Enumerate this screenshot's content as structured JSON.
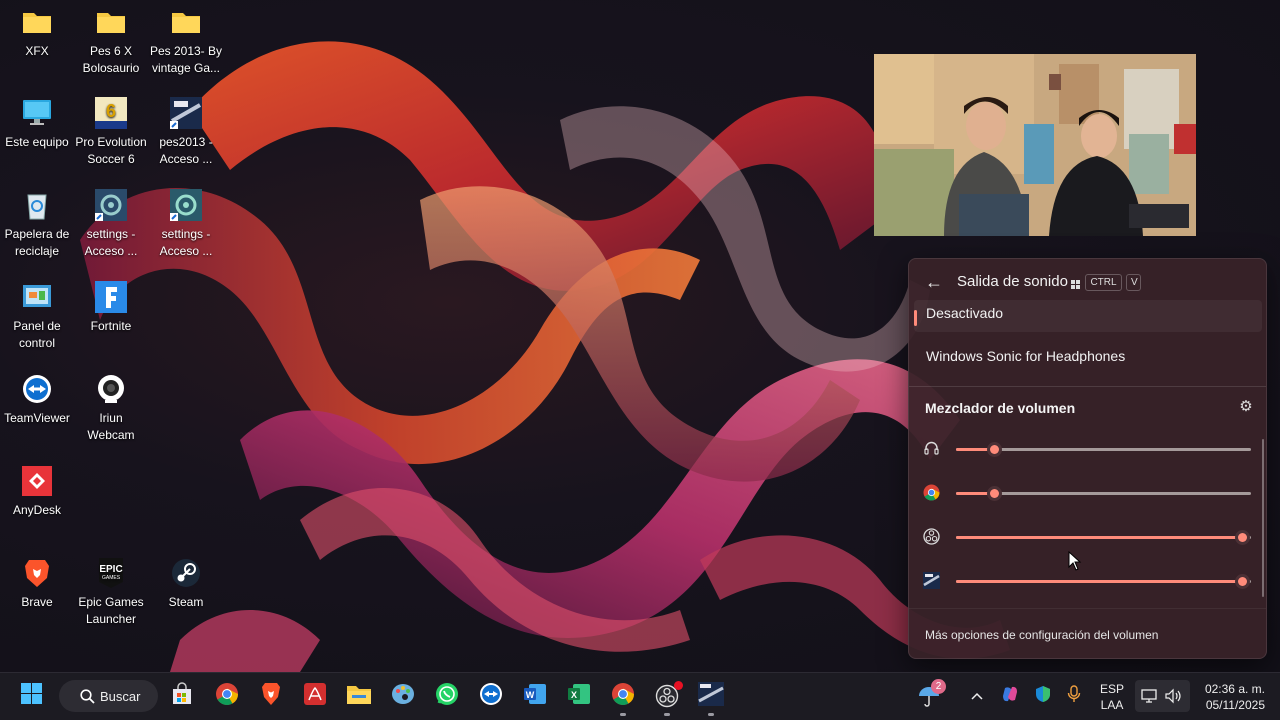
{
  "desktop": {
    "icons": [
      {
        "label": "XFX",
        "icon": "folder-icon"
      },
      {
        "label": "Pes 6 X\nBolosaurio",
        "icon": "folder-icon"
      },
      {
        "label": "Pes 2013- By\nvintage Ga...",
        "icon": "folder-icon"
      },
      {
        "label": "Este equipo",
        "icon": "computer-icon"
      },
      {
        "label": "Pro Evolution\nSoccer 6",
        "icon": "pes6-icon"
      },
      {
        "label": "pes2013 -\nAcceso ...",
        "icon": "pes2013-icon"
      },
      {
        "label": "Papelera de\nreciclaje",
        "icon": "recycle-bin-icon"
      },
      {
        "label": "settings -\nAcceso ...",
        "icon": "settings-shortcut-icon"
      },
      {
        "label": "settings -\nAcceso ...",
        "icon": "settings-shortcut-icon"
      },
      {
        "label": "Panel de\ncontrol",
        "icon": "control-panel-icon"
      },
      {
        "label": "Fortnite",
        "icon": "fortnite-icon"
      },
      {
        "label": "TeamViewer",
        "icon": "teamviewer-icon"
      },
      {
        "label": "Iriun\nWebcam",
        "icon": "iriun-webcam-icon"
      },
      {
        "label": "AnyDesk",
        "icon": "anydesk-icon"
      },
      {
        "label": "Brave",
        "icon": "brave-icon"
      },
      {
        "label": "Epic Games\nLauncher",
        "icon": "epic-games-icon"
      },
      {
        "label": "Steam",
        "icon": "steam-icon"
      }
    ]
  },
  "flyout": {
    "title": "Salida de sonido",
    "shortcut_keys": [
      "CTRL",
      "V"
    ],
    "spatial_options": [
      {
        "label": "Desactivado",
        "selected": true
      },
      {
        "label": "Windows Sonic for Headphones",
        "selected": false
      }
    ],
    "mixer_title": "Mezclador de volumen",
    "mixer_rows": [
      {
        "app_icon": "headphones-icon",
        "volume_fraction": 0.13
      },
      {
        "app_icon": "chrome-icon",
        "volume_fraction": 0.13
      },
      {
        "app_icon": "obs-icon",
        "volume_fraction": 0.97
      },
      {
        "app_icon": "pes2013-app-icon",
        "volume_fraction": 0.97
      }
    ],
    "footer": "Más opciones de configuración del volumen"
  },
  "taskbar": {
    "search_label": "Buscar",
    "apps": [
      "start-icon",
      "store-icon",
      "chrome-icon",
      "brave-icon",
      "acrobat-icon",
      "file-explorer-icon",
      "paint-icon",
      "whatsapp-icon",
      "teamviewer-icon",
      "word-icon",
      "excel-icon",
      "chrome-icon",
      "obs-icon",
      "pes2013-icon"
    ],
    "weather_badge": "2",
    "language_line1": "ESP",
    "language_line2": "LAA",
    "time": "02:36 a. m.",
    "date": "05/11/2025"
  },
  "colors": {
    "accent": "#ff8b7a",
    "flyout_bg": "#382228",
    "taskbar_bg": "#1c1b22"
  }
}
